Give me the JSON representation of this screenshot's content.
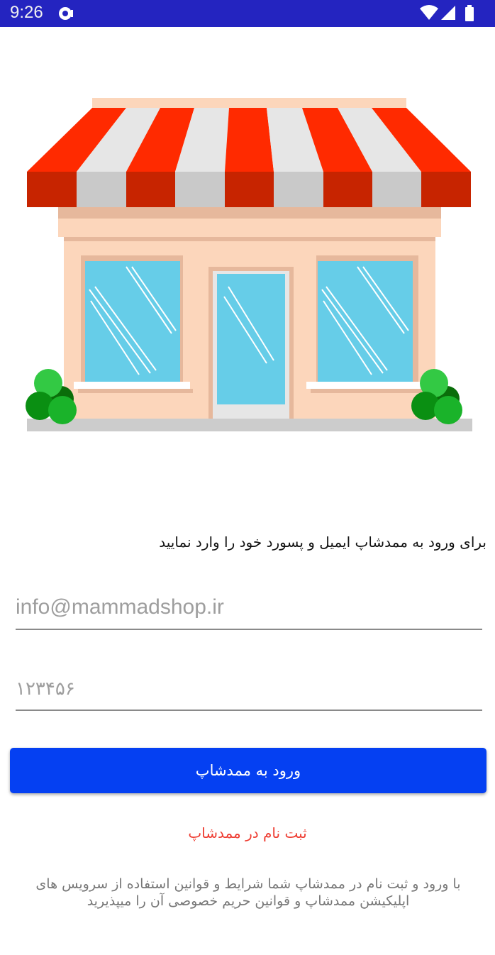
{
  "status_bar": {
    "time": "9:26",
    "icons": [
      "settings-icon",
      "wifi-icon",
      "signal-icon",
      "battery-icon"
    ],
    "background": "#2424c0"
  },
  "illustration": {
    "subject": "storefront-illustration"
  },
  "login": {
    "instruction": "برای ورود به ممدشاپ ایمیل و پسورد خود را وارد نمایید",
    "email_placeholder": "info@mammadshop.ir",
    "email_value": "",
    "password_placeholder": "۱۲۳۴۵۶",
    "password_value": "",
    "login_button": "ورود به ممدشاپ",
    "register_link": "ثبت نام در ممدشاپ",
    "terms": "با ورود و ثبت نام در ممدشاپ شما شرایط و قوانین استفاده از سرویس های اپلیکیشن ممدشاپ و قوانین حریم خصوصی آن را میپذیرید"
  },
  "colors": {
    "primary": "#0540f2",
    "link": "#ee3b30",
    "awning_red": "#ff2a00",
    "awning_white": "#e6e6e6",
    "wall": "#fcd6bb",
    "glass": "#66cde8",
    "bush": "#1ab32a"
  }
}
